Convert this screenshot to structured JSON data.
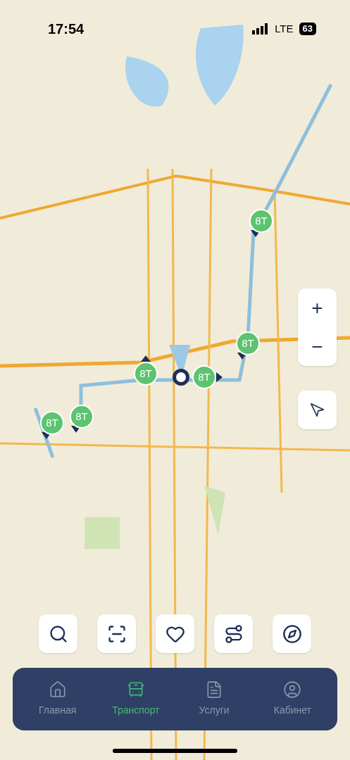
{
  "status_bar": {
    "time": "17:54",
    "network": "LTE",
    "battery": "63"
  },
  "vehicles": [
    {
      "route": "8T"
    },
    {
      "route": "8T"
    },
    {
      "route": "8T"
    },
    {
      "route": "8T"
    },
    {
      "route": "8T"
    },
    {
      "route": "8T"
    }
  ],
  "map_controls": {
    "zoom_in": "+",
    "zoom_out": "−"
  },
  "tabs": [
    {
      "label": "Главная",
      "selected": false
    },
    {
      "label": "Транспорт",
      "selected": true
    },
    {
      "label": "Услуги",
      "selected": false
    },
    {
      "label": "Кабинет",
      "selected": false
    }
  ]
}
